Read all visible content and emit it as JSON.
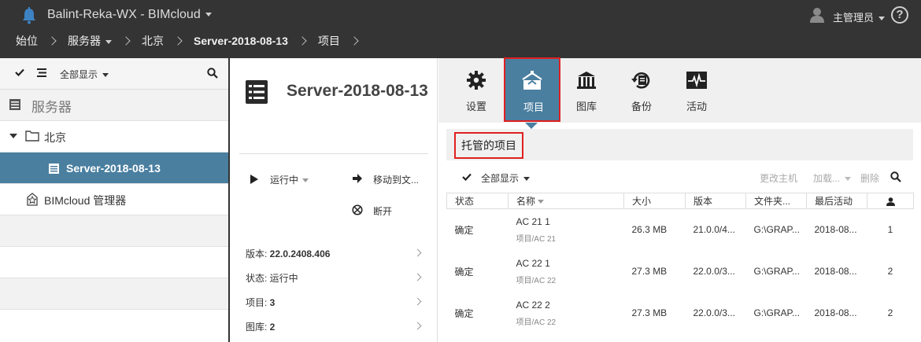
{
  "header": {
    "app_title": "Balint-Reka-WX - BIMcloud",
    "user_name": "主管理员",
    "help_symbol": "?"
  },
  "breadcrumb": {
    "items": [
      "始位",
      "服务器",
      "北京",
      "Server-2018-08-13",
      "项目"
    ]
  },
  "sidebar": {
    "show_all": "全部显示",
    "servers_label": "服务器",
    "tree": {
      "beijing": "北京",
      "server": "Server-2018-08-13",
      "manager": "BIMcloud 管理器"
    }
  },
  "middle": {
    "title": "Server-2018-08-13",
    "running": "运行中",
    "move_to": "移动到文...",
    "disconnect": "断开",
    "info": [
      {
        "label": "版本: ",
        "value": "22.0.2408.406"
      },
      {
        "label": "状态: ",
        "value": "运行中"
      },
      {
        "label": "项目: ",
        "value": "3"
      },
      {
        "label": "图库: ",
        "value": "2"
      }
    ]
  },
  "tabs": [
    {
      "label": "设置",
      "icon": "gear-icon"
    },
    {
      "label": "项目",
      "icon": "projects-icon",
      "active": true
    },
    {
      "label": "图库",
      "icon": "library-icon"
    },
    {
      "label": "备份",
      "icon": "backup-icon"
    },
    {
      "label": "活动",
      "icon": "activity-icon"
    }
  ],
  "hosted": {
    "title": "托管的项目",
    "show_all": "全部显示",
    "change_host": "更改主机",
    "load": "加载...",
    "delete": "删除"
  },
  "table": {
    "headers": {
      "status": "状态",
      "name": "名称",
      "size": "大小",
      "version": "版本",
      "folder": "文件夹...",
      "last_activity": "最后活动"
    },
    "rows": [
      {
        "status": "确定",
        "name": "AC 21 1",
        "path": "项目/AC 21",
        "size": "26.3 MB",
        "version": "21.0.0/4...",
        "folder": "G:\\GRAP...",
        "last": "2018-08...",
        "users": "1"
      },
      {
        "status": "确定",
        "name": "AC 22 1",
        "path": "项目/AC 22",
        "size": "27.3 MB",
        "version": "22.0.0/3...",
        "folder": "G:\\GRAP...",
        "last": "2018-08...",
        "users": "2"
      },
      {
        "status": "确定",
        "name": "AC 22 2",
        "path": "项目/AC 22",
        "size": "27.3 MB",
        "version": "22.0.0/3...",
        "folder": "G:\\GRAP...",
        "last": "2018-08...",
        "users": "2"
      }
    ]
  },
  "colors": {
    "header_bg": "#343434",
    "accent": "#4a7fa0",
    "highlight": "#e02020",
    "bell": "#3d83c4"
  }
}
